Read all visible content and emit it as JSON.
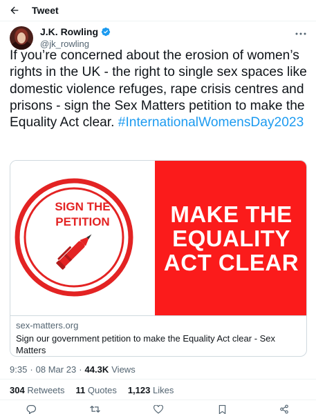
{
  "header": {
    "title": "Tweet",
    "back_icon": "arrow-left-icon"
  },
  "author": {
    "display_name": "J.K. Rowling",
    "handle": "@jk_rowling",
    "verified_icon": "verified-badge-icon",
    "verified_color": "#1d9bf0"
  },
  "tweet": {
    "text": "If you’re concerned about the erosion of women’s rights in the UK - the right to single sex spaces like domestic violence refuges, rape crisis centres and prisons - sign the Sex Matters petition to make the Equality Act clear.",
    "hashtag": "#InternationalWomensDay2023"
  },
  "card": {
    "image": {
      "left_text": [
        "SIGN THE",
        "PETITION"
      ],
      "right_text": [
        "MAKE THE",
        "EQUALITY",
        "ACT CLEAR"
      ],
      "brand_red": "#fb1b1b",
      "pen_icon": "pen-icon"
    },
    "domain": "sex-matters.org",
    "title": "Sign our government petition to make the Equality Act clear - Sex Matters"
  },
  "meta": {
    "time": "9:35",
    "separator": "·",
    "date": "08 Mar 23",
    "views_count": "44.3K",
    "views_label": "Views"
  },
  "stats": {
    "retweets_count": "304",
    "retweets_label": "Retweets",
    "quotes_count": "11",
    "quotes_label": "Quotes",
    "likes_count": "1,123",
    "likes_label": "Likes"
  },
  "actions": [
    "reply-icon",
    "retweet-icon",
    "like-icon",
    "bookmark-icon",
    "share-icon"
  ],
  "colors": {
    "link": "#1d9bf0",
    "muted": "#536471",
    "text": "#0f1419"
  }
}
